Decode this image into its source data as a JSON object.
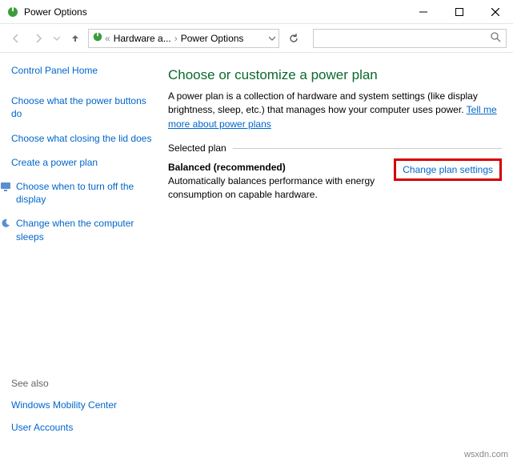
{
  "window": {
    "title": "Power Options"
  },
  "breadcrumb": {
    "level1": "Hardware a...",
    "level2": "Power Options"
  },
  "sidebar": {
    "home": "Control Panel Home",
    "links": [
      "Choose what the power buttons do",
      "Choose what closing the lid does",
      "Create a power plan",
      "Choose when to turn off the display",
      "Change when the computer sleeps"
    ],
    "seealso_label": "See also",
    "seealso": [
      "Windows Mobility Center",
      "User Accounts"
    ]
  },
  "main": {
    "heading": "Choose or customize a power plan",
    "description_pre": "A power plan is a collection of hardware and system settings (like display brightness, sleep, etc.) that manages how your computer uses power. ",
    "description_link": "Tell me more about power plans",
    "section_label": "Selected plan",
    "plan_title": "Balanced (recommended)",
    "plan_desc": "Automatically balances performance with energy consumption on capable hardware.",
    "change_link": "Change plan settings"
  },
  "watermark": "wsxdn.com"
}
